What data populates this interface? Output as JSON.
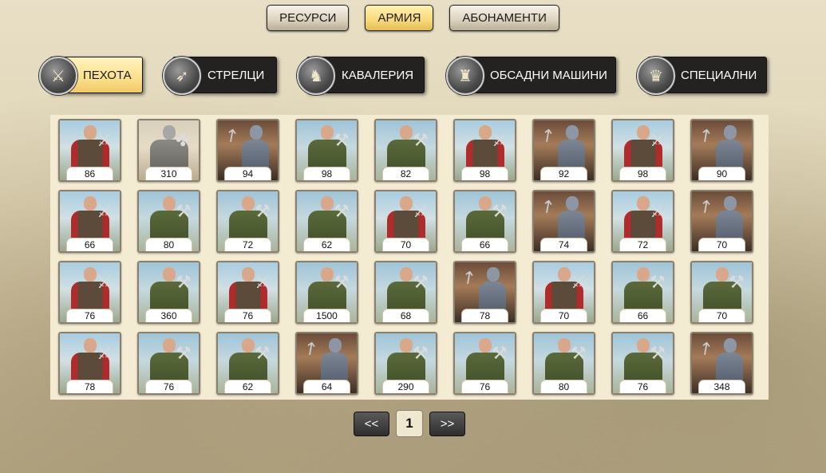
{
  "top_tabs": [
    {
      "label": "РЕСУРСИ",
      "active": false
    },
    {
      "label": "АРМИЯ",
      "active": true
    },
    {
      "label": "АБОНАМЕНТИ",
      "active": false
    }
  ],
  "categories": [
    {
      "label": "ПЕХОТА",
      "icon": "infantry-icon",
      "active": true
    },
    {
      "label": "СТРЕЛЦИ",
      "icon": "archers-icon",
      "active": false
    },
    {
      "label": "КАВАЛЕРИЯ",
      "icon": "cavalry-icon",
      "active": false
    },
    {
      "label": "ОБСАДНИ МАШИНИ",
      "icon": "siege-engine-icon",
      "active": false
    },
    {
      "label": "СПЕЦИАЛНИ",
      "icon": "helmet-icon",
      "active": false
    }
  ],
  "units": [
    {
      "count": "86",
      "type": "sword"
    },
    {
      "count": "310",
      "type": "mace"
    },
    {
      "count": "94",
      "type": "spear"
    },
    {
      "count": "98",
      "type": "axe"
    },
    {
      "count": "82",
      "type": "axe"
    },
    {
      "count": "98",
      "type": "sword"
    },
    {
      "count": "92",
      "type": "spear"
    },
    {
      "count": "98",
      "type": "sword"
    },
    {
      "count": "90",
      "type": "spear"
    },
    {
      "count": "66",
      "type": "sword"
    },
    {
      "count": "80",
      "type": "axe"
    },
    {
      "count": "72",
      "type": "axe"
    },
    {
      "count": "62",
      "type": "axe"
    },
    {
      "count": "70",
      "type": "sword"
    },
    {
      "count": "66",
      "type": "axe"
    },
    {
      "count": "74",
      "type": "spear"
    },
    {
      "count": "72",
      "type": "sword"
    },
    {
      "count": "70",
      "type": "spear"
    },
    {
      "count": "76",
      "type": "sword"
    },
    {
      "count": "360",
      "type": "axe"
    },
    {
      "count": "76",
      "type": "sword"
    },
    {
      "count": "1500",
      "type": "axe"
    },
    {
      "count": "68",
      "type": "axe"
    },
    {
      "count": "78",
      "type": "spear"
    },
    {
      "count": "70",
      "type": "sword"
    },
    {
      "count": "66",
      "type": "axe"
    },
    {
      "count": "70",
      "type": "axe"
    },
    {
      "count": "78",
      "type": "sword"
    },
    {
      "count": "76",
      "type": "axe"
    },
    {
      "count": "62",
      "type": "axe"
    },
    {
      "count": "64",
      "type": "spear"
    },
    {
      "count": "290",
      "type": "axe"
    },
    {
      "count": "76",
      "type": "axe"
    },
    {
      "count": "80",
      "type": "axe"
    },
    {
      "count": "76",
      "type": "axe"
    },
    {
      "count": "348",
      "type": "spear"
    }
  ],
  "pagination": {
    "prev": "<<",
    "page": "1",
    "next": ">>"
  }
}
